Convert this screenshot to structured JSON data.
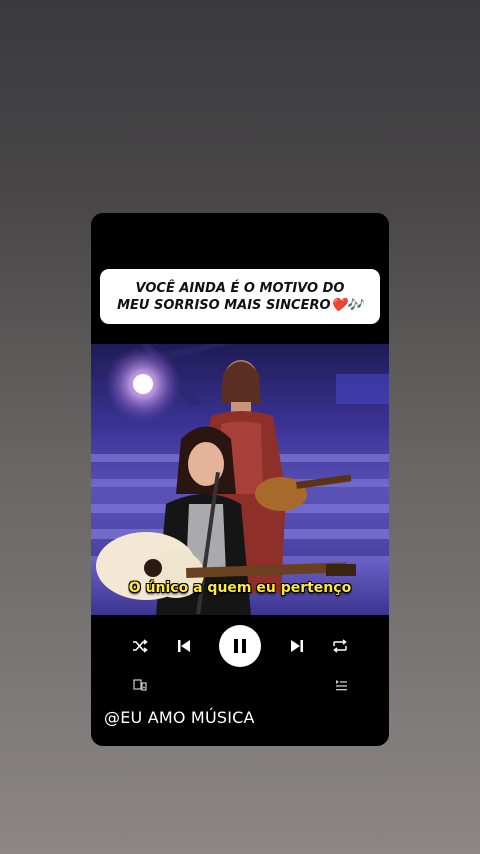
{
  "post": {
    "caption_line1": "VOCÊ AINDA É O MOTIVO DO",
    "caption_line2": "MEU SORRISO MAIS SINCERO",
    "caption_emoji": "❤️🎶",
    "subtitle": "O único a quem eu pertenço",
    "handle": "@EU AMO MÚSICA"
  },
  "player": {
    "state": "playing",
    "controls": [
      "shuffle-icon",
      "previous-icon",
      "pause-icon",
      "next-icon",
      "repeat-icon"
    ],
    "secondary": [
      "devices-icon",
      "queue-icon"
    ]
  },
  "colors": {
    "card": "#000000",
    "subtitle": "#ffe83a",
    "stage_light": "#5b52b8"
  }
}
